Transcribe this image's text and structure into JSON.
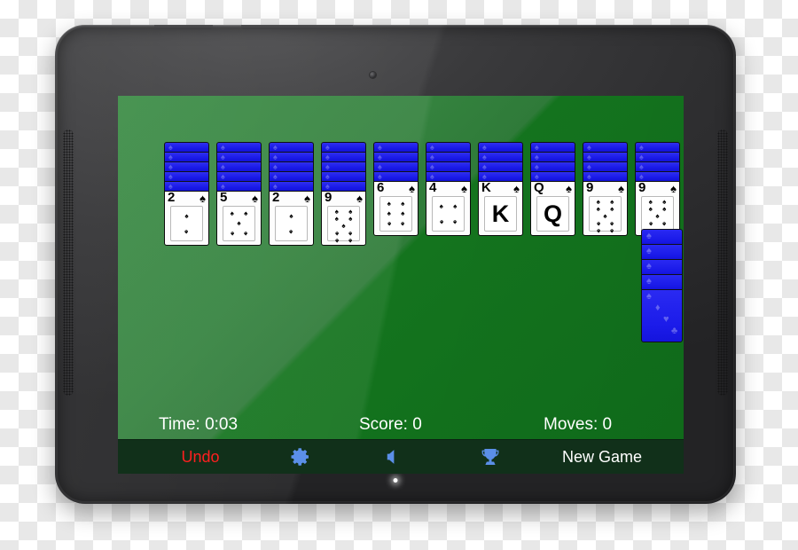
{
  "app": {
    "name": "Spider Solitaire",
    "screen_bg_light": "#3b8c45",
    "screen_bg_dark": "#14741e",
    "card_back_color": "#1b1be9",
    "accent_icon_color": "#5b8fe8",
    "undo_color": "#ff1f1f"
  },
  "tableau": {
    "columns": [
      {
        "index": 1,
        "facedown_count": 5,
        "top_card": {
          "rank": "2",
          "suit": "spade",
          "suit_glyph": "♠",
          "pip_layout": "lay-2"
        }
      },
      {
        "index": 2,
        "facedown_count": 5,
        "top_card": {
          "rank": "5",
          "suit": "spade",
          "suit_glyph": "♠",
          "pip_layout": "lay-5"
        }
      },
      {
        "index": 3,
        "facedown_count": 5,
        "top_card": {
          "rank": "2",
          "suit": "spade",
          "suit_glyph": "♠",
          "pip_layout": "lay-2"
        }
      },
      {
        "index": 4,
        "facedown_count": 5,
        "top_card": {
          "rank": "9",
          "suit": "spade",
          "suit_glyph": "♠",
          "pip_layout": "lay-9"
        }
      },
      {
        "index": 5,
        "facedown_count": 4,
        "top_card": {
          "rank": "6",
          "suit": "spade",
          "suit_glyph": "♠",
          "pip_layout": "lay-6"
        }
      },
      {
        "index": 6,
        "facedown_count": 4,
        "top_card": {
          "rank": "4",
          "suit": "spade",
          "suit_glyph": "♠",
          "pip_layout": "lay-4"
        }
      },
      {
        "index": 7,
        "facedown_count": 4,
        "top_card": {
          "rank": "K",
          "suit": "spade",
          "suit_glyph": "♠",
          "pip_layout": "face"
        }
      },
      {
        "index": 8,
        "facedown_count": 4,
        "top_card": {
          "rank": "Q",
          "suit": "spade",
          "suit_glyph": "♠",
          "pip_layout": "face"
        }
      },
      {
        "index": 9,
        "facedown_count": 4,
        "top_card": {
          "rank": "9",
          "suit": "spade",
          "suit_glyph": "♠",
          "pip_layout": "lay-9"
        }
      },
      {
        "index": 10,
        "facedown_count": 4,
        "top_card": {
          "rank": "9",
          "suit": "spade",
          "suit_glyph": "♠",
          "pip_layout": "lay-9"
        }
      }
    ]
  },
  "stock": {
    "deal_piles": 5,
    "back_glyphs": [
      "♠",
      "♦",
      "♥",
      "♣"
    ]
  },
  "status": {
    "time_label": "Time: 0:03",
    "score_label": "Score: 0",
    "moves_label": "Moves: 0"
  },
  "toolbar": {
    "undo_label": "Undo",
    "settings_icon": "gear-icon",
    "sound_icon": "speaker-mute-icon",
    "trophy_icon": "trophy-icon",
    "new_game_label": "New Game"
  }
}
